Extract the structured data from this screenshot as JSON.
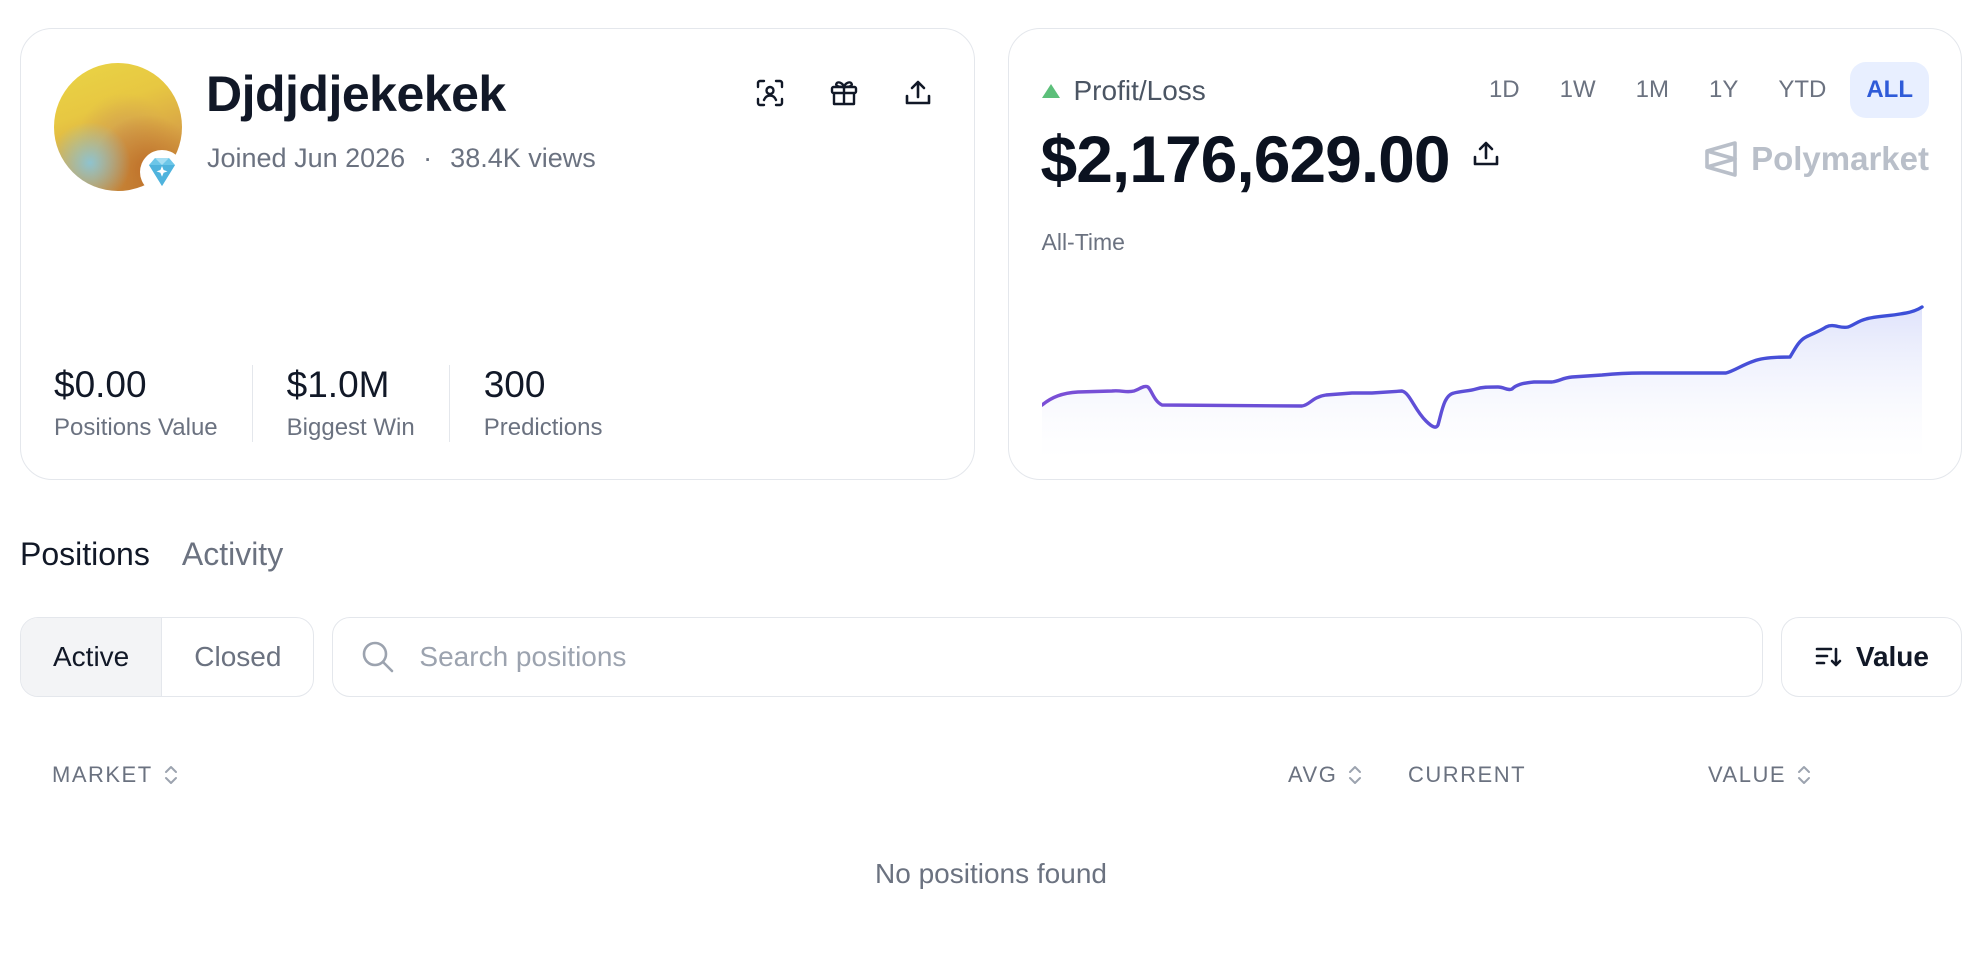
{
  "profile": {
    "username": "Djdjdjekekek",
    "joined": "Joined Jun 2026",
    "separator": "·",
    "views": "38.4K views",
    "stats": [
      {
        "value": "$0.00",
        "label": "Positions Value"
      },
      {
        "value": "$1.0M",
        "label": "Biggest Win"
      },
      {
        "value": "300",
        "label": "Predictions"
      }
    ],
    "actions": [
      "scan-icon",
      "gift-icon",
      "share-icon"
    ]
  },
  "pnl": {
    "label": "Profit/Loss",
    "value": "$2,176,629.00",
    "period": "All-Time",
    "brand": "Polymarket",
    "ranges": [
      "1D",
      "1W",
      "1M",
      "1Y",
      "YTD",
      "ALL"
    ],
    "active_range": "ALL",
    "colors": {
      "up": "#5cbf7a",
      "line_start": "#7b4fd6",
      "line_end": "#3b4fd8",
      "fill": "#e3e6fb"
    }
  },
  "tabs": [
    {
      "label": "Positions",
      "active": true
    },
    {
      "label": "Activity",
      "active": false
    }
  ],
  "filters": {
    "segments": [
      {
        "label": "Active",
        "active": true
      },
      {
        "label": "Closed",
        "active": false
      }
    ],
    "search_placeholder": "Search positions",
    "sort_label": "Value"
  },
  "table": {
    "columns": [
      {
        "label": "MARKET",
        "sortable": true
      },
      {
        "label": "AVG",
        "sortable": true
      },
      {
        "label": "CURRENT",
        "sortable": false
      },
      {
        "label": "VALUE",
        "sortable": true
      }
    ],
    "empty_text": "No positions found"
  }
}
